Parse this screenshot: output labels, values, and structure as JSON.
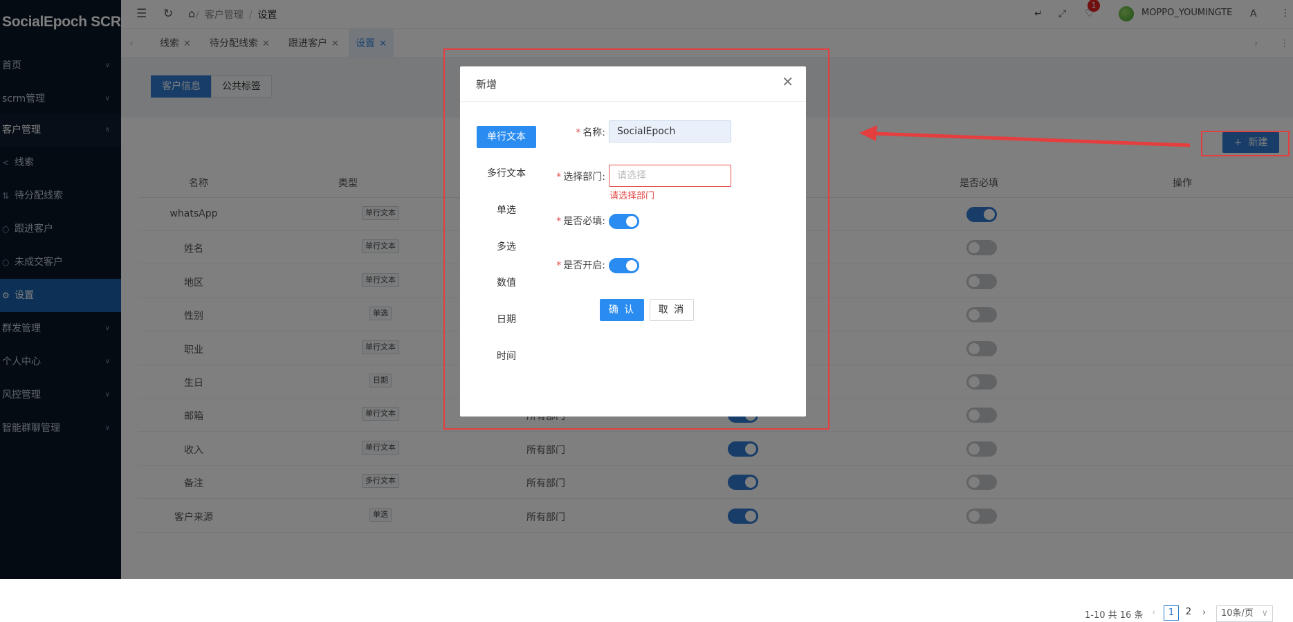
{
  "brand": "SocialEpoch SCRM",
  "sidebar": {
    "items": [
      {
        "label": "首页"
      },
      {
        "label": "scrm管理"
      },
      {
        "label": "客户管理"
      },
      {
        "label": "线索"
      },
      {
        "label": "待分配线索"
      },
      {
        "label": "跟进客户"
      },
      {
        "label": "未成交客户"
      },
      {
        "label": "设置"
      },
      {
        "label": "群发管理"
      },
      {
        "label": "个人中心"
      },
      {
        "label": "风控管理"
      },
      {
        "label": "智能群聊管理"
      }
    ]
  },
  "header": {
    "breadcrumb": [
      "客户管理",
      "设置"
    ],
    "notification_count": "1",
    "username": "MOPPO_YOUMINGTE"
  },
  "tabs": [
    {
      "label": "线索"
    },
    {
      "label": "待分配线索"
    },
    {
      "label": "跟进客户"
    },
    {
      "label": "设置"
    }
  ],
  "subtabs": [
    "客户信息",
    "公共标签"
  ],
  "toolbar": {
    "new_label": "新建"
  },
  "table": {
    "columns": [
      "名称",
      "类型",
      "是否必填",
      "操作"
    ],
    "rows": [
      {
        "name": "whatsApp",
        "type": "单行文本",
        "dept": "",
        "enabled": null,
        "required": true
      },
      {
        "name": "姓名",
        "type": "单行文本",
        "dept": "",
        "enabled": null,
        "required": false
      },
      {
        "name": "地区",
        "type": "单行文本",
        "dept": "",
        "enabled": null,
        "required": false
      },
      {
        "name": "性别",
        "type": "单选",
        "dept": "",
        "enabled": null,
        "required": false
      },
      {
        "name": "职业",
        "type": "单行文本",
        "dept": "",
        "enabled": null,
        "required": false
      },
      {
        "name": "生日",
        "type": "日期",
        "dept": "",
        "enabled": null,
        "required": false
      },
      {
        "name": "邮箱",
        "type": "单行文本",
        "dept": "所有部门",
        "enabled": true,
        "required": false
      },
      {
        "name": "收入",
        "type": "单行文本",
        "dept": "所有部门",
        "enabled": true,
        "required": false
      },
      {
        "name": "备注",
        "type": "多行文本",
        "dept": "所有部门",
        "enabled": true,
        "required": false
      },
      {
        "name": "客户来源",
        "type": "单选",
        "dept": "所有部门",
        "enabled": true,
        "required": false
      }
    ]
  },
  "pagination": {
    "summary": "1-10 共 16 条",
    "pages": [
      "1",
      "2"
    ],
    "current": "1",
    "page_size": "10条/页"
  },
  "dialog": {
    "title": "新增",
    "field_types": [
      "单行文本",
      "多行文本",
      "单选",
      "多选",
      "数值",
      "日期",
      "时间"
    ],
    "name_label": "名称:",
    "name_value": "SocialEpoch",
    "dept_label": "选择部门:",
    "dept_placeholder": "请选择",
    "dept_error": "请选择部门",
    "required_label": "是否必填:",
    "enabled_label": "是否开启:",
    "required_on": true,
    "enabled_on": true,
    "confirm_label": "确 认",
    "cancel_label": "取 消"
  },
  "colors": {
    "sidebar_bg": "#0b1626",
    "accent": "#2f7ad0",
    "dialog_accent": "#2a8cf0",
    "error": "#e34b4b",
    "annotation": "#e53e3e"
  }
}
